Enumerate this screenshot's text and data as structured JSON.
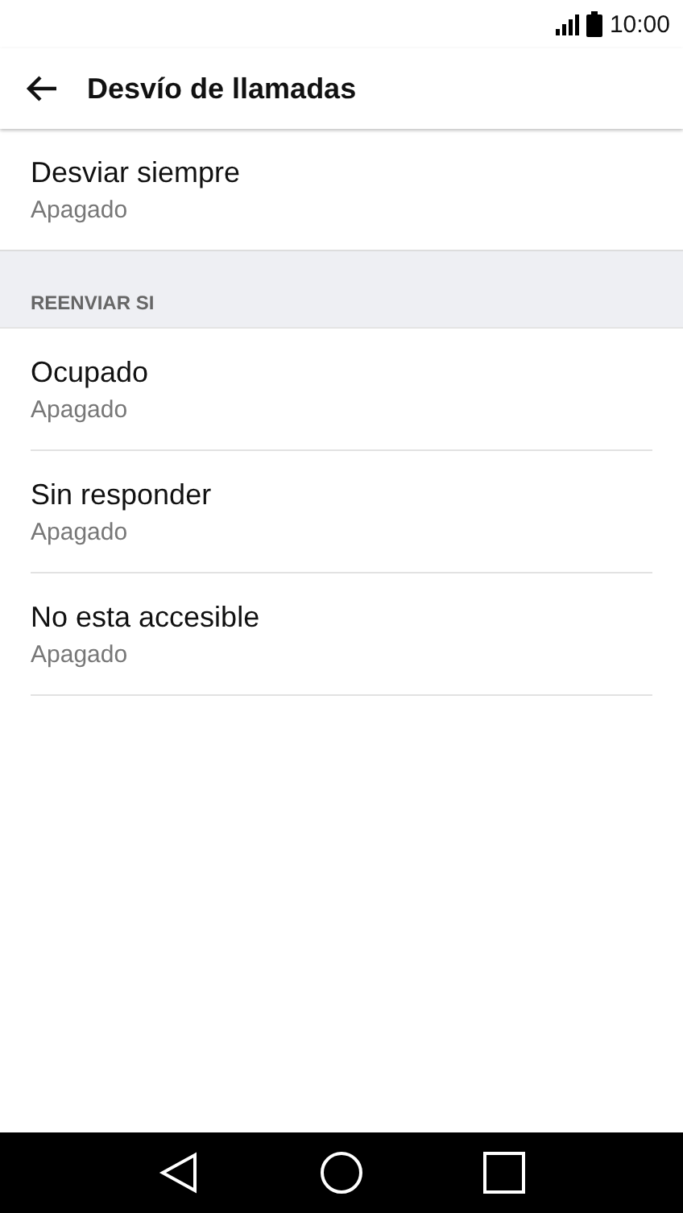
{
  "status_bar": {
    "time": "10:00"
  },
  "app_bar": {
    "title": "Desvío de llamadas"
  },
  "items": [
    {
      "title": "Desviar siempre",
      "summary": "Apagado"
    }
  ],
  "section": {
    "header": "REENVIAR SI",
    "items": [
      {
        "title": "Ocupado",
        "summary": "Apagado"
      },
      {
        "title": "Sin responder",
        "summary": "Apagado"
      },
      {
        "title": "No esta accesible",
        "summary": "Apagado"
      }
    ]
  }
}
